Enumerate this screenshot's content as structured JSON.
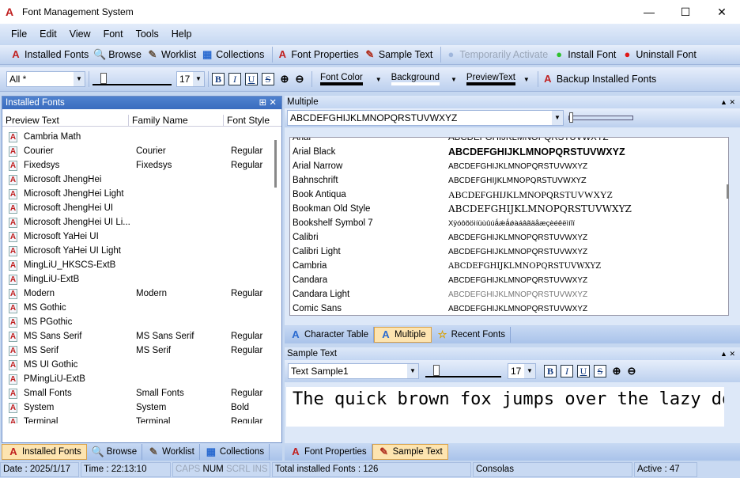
{
  "window": {
    "title": "Font Management System",
    "minimize": "—",
    "maximize": "☐",
    "close": "✕"
  },
  "menu": [
    "File",
    "Edit",
    "View",
    "Font",
    "Tools",
    "Help"
  ],
  "toolbar1": [
    {
      "label": "Installed Fonts",
      "icon": "A",
      "color": "#c02020"
    },
    {
      "label": "Browse",
      "icon": "🔍",
      "color": "#345"
    },
    {
      "label": "Worklist",
      "icon": "✎",
      "color": "#654"
    },
    {
      "label": "Collections",
      "icon": "▦",
      "color": "#2a6ad0"
    },
    {
      "label": "Font Properties",
      "icon": "A",
      "color": "#c02020"
    },
    {
      "label": "Sample Text",
      "icon": "✎",
      "color": "#b03020"
    },
    {
      "label": "Temporarily Activate",
      "icon": "●",
      "color": "#9fb6dc",
      "disabled": true
    },
    {
      "label": "Install Font",
      "icon": "●",
      "color": "#2ec12e"
    },
    {
      "label": "Uninstall Font",
      "icon": "●",
      "color": "#e01818"
    }
  ],
  "toolbar2": {
    "filter": "All *",
    "size": "17",
    "bold": "B",
    "italic": "I",
    "underline": "U",
    "strike": "S",
    "font_color": "Font Color",
    "background": "Background",
    "preview_text": "PreviewText",
    "backup": "Backup Installed Fonts"
  },
  "installed_panel": {
    "title": "Installed Fonts",
    "columns": [
      "Preview Text",
      "Family Name",
      "Font Style"
    ],
    "rows": [
      [
        "Cambria Math",
        "",
        ""
      ],
      [
        "Courier",
        "Courier",
        "Regular"
      ],
      [
        "Fixedsys",
        "Fixedsys",
        "Regular"
      ],
      [
        "Microsoft JhengHei",
        "",
        ""
      ],
      [
        "Microsoft JhengHei Light",
        "",
        ""
      ],
      [
        "Microsoft JhengHei UI",
        "",
        ""
      ],
      [
        "Microsoft JhengHei UI Li...",
        "",
        ""
      ],
      [
        "Microsoft YaHei UI",
        "",
        ""
      ],
      [
        "Microsoft YaHei UI Light",
        "",
        ""
      ],
      [
        "MingLiU_HKSCS-ExtB",
        "",
        ""
      ],
      [
        "MingLiU-ExtB",
        "",
        ""
      ],
      [
        "Modern",
        "Modern",
        "Regular"
      ],
      [
        "MS Gothic",
        "",
        ""
      ],
      [
        "MS PGothic",
        "",
        ""
      ],
      [
        "MS Sans Serif",
        "MS Sans Serif",
        "Regular"
      ],
      [
        "MS Serif",
        "MS Serif",
        "Regular"
      ],
      [
        "MS UI Gothic",
        "",
        ""
      ],
      [
        "PMingLiU-ExtB",
        "",
        ""
      ],
      [
        "Small Fonts",
        "Small Fonts",
        "Regular"
      ],
      [
        "System",
        "System",
        "Bold"
      ],
      [
        "Terminal",
        "Terminal",
        "Regular"
      ]
    ],
    "tabs": [
      "Installed Fonts",
      "Browse",
      "Worklist",
      "Collections"
    ]
  },
  "multiple_panel": {
    "title": "Multiple",
    "preview_input": "ABCDEFGHIJKLMNOPQRSTUVWXYZ",
    "rows": [
      [
        "Arial",
        "ABCDEFGHIJKLMNOPQRSTUVWXYZ"
      ],
      [
        "Arial Black",
        "ABCDEFGHIJKLMNOPQRSTUVWXYZ"
      ],
      [
        "Arial Narrow",
        "ABCDEFGHIJKLMNOPQRSTUVWXYZ"
      ],
      [
        "Bahnschrift",
        "ABCDEFGHIJKLMNOPQRSTUVWXYZ"
      ],
      [
        "Book Antiqua",
        "ABCDEFGHIJKLMNOPQRSTUVWXYZ"
      ],
      [
        "Bookman Old Style",
        "ABCDEFGHIJKLMNOPQRSTUVWXYZ"
      ],
      [
        "Bookshelf Symbol 7",
        "Xÿóôõöìíüùûúǻǽǻǿàáâãäåæçèéêëìíîï"
      ],
      [
        "Calibri",
        "ABCDEFGHIJKLMNOPQRSTUVWXYZ"
      ],
      [
        "Calibri Light",
        "ABCDEFGHIJKLMNOPQRSTUVWXYZ"
      ],
      [
        "Cambria",
        "ABCDEFGHIJKLMNOPQRSTUVWXYZ"
      ],
      [
        "Candara",
        "ABCDEFGHIJKLMNOPQRSTUVWXYZ"
      ],
      [
        "Candara Light",
        "ABCDEFGHIJKLMNOPQRSTUVWXYZ"
      ],
      [
        "Comic Sans",
        "ABCDEFGHIJKLMNOPQRSTUVWXYZ"
      ]
    ],
    "tabs": [
      "Character Table",
      "Multiple",
      "Recent Fonts"
    ]
  },
  "sample_panel": {
    "title": "Sample Text",
    "sample_select": "Text Sample1",
    "size": "17",
    "text": "The quick brown fox jumps over the lazy dog",
    "tabs": [
      "Font Properties",
      "Sample Text"
    ]
  },
  "status": {
    "date": "Date : 2025/1/17",
    "time": "Time : 22:13:10",
    "caps": "CAPS",
    "num": "NUM",
    "scrl": "SCRL",
    "ins": "INS",
    "total": "Total installed Fonts : 126",
    "font": "Consolas",
    "active": "Active : 47"
  }
}
